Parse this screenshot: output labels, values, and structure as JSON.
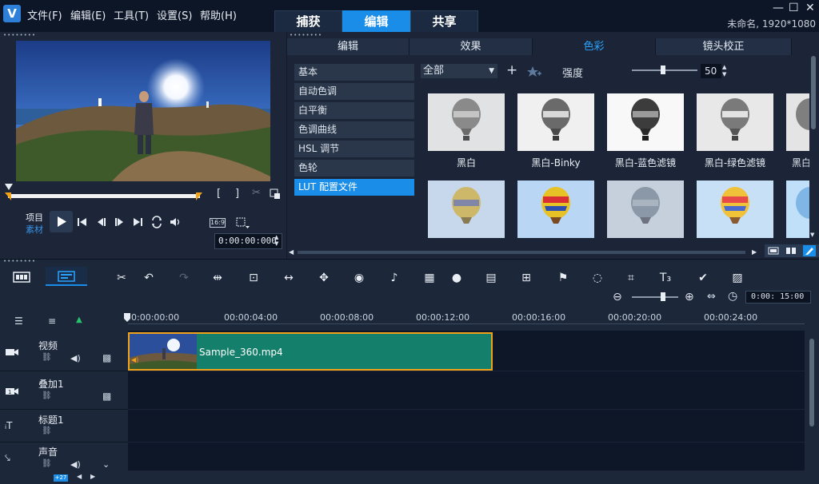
{
  "app": {
    "logo_letter": "V",
    "menu": [
      "文件(F)",
      "编辑(E)",
      "工具(T)",
      "设置(S)",
      "帮助(H)"
    ],
    "main_tabs": [
      "捕获",
      "编辑",
      "共享"
    ],
    "active_main_tab": "编辑",
    "project_info": "未命名, 1920*1080",
    "window_buttons": [
      "—",
      "☐",
      "✕"
    ]
  },
  "player": {
    "grip": "••••••••",
    "mode_labels": {
      "project": "项目",
      "clip": "素材"
    },
    "trim_buttons": [
      "[",
      "]"
    ],
    "aspect": "16:9",
    "timecode": "0:00:00:000"
  },
  "edit_panel": {
    "grip": "••••••••",
    "subtabs": [
      "编辑",
      "效果",
      "色彩",
      "镜头校正"
    ],
    "active_subtab": "色彩",
    "categories": [
      "基本",
      "自动色调",
      "白平衡",
      "色调曲线",
      "HSL 调节",
      "色轮",
      "LUT 配置文件"
    ],
    "active_category": "LUT 配置文件",
    "filter_dropdown": "全部",
    "add_label": "+",
    "strength_label": "强度",
    "strength_value": "50",
    "thumb_labels_row1": [
      "黑白",
      "黑白-Binky",
      "黑白-蓝色滤镜",
      "黑白-绿色滤镜",
      "黑白"
    ]
  },
  "timeline": {
    "zoom_timecode": "0:00: 15:00",
    "ruler": [
      "0:00:00:00",
      "00:00:04:00",
      "00:00:08:00",
      "00:00:12:00",
      "00:00:16:00",
      "00:00:20:00",
      "00:00:24:00"
    ],
    "tracks": [
      "视频",
      "叠加1",
      "标题1",
      "声音"
    ],
    "clip_name": "Sample_360.mp4",
    "bottom_badge": "+27"
  },
  "colors": {
    "accent": "#1a8de8",
    "clip_green": "#147f6a",
    "clip_border": "#f0a21a"
  }
}
